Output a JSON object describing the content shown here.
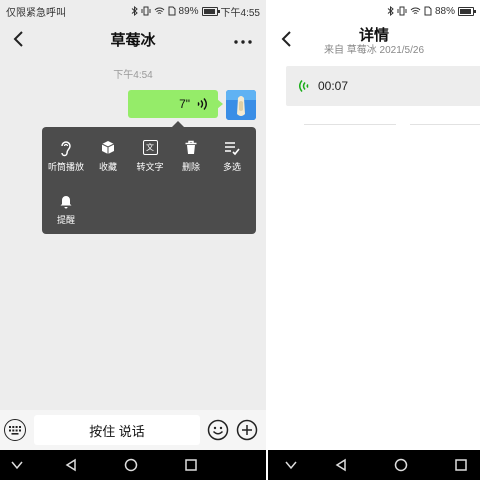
{
  "left": {
    "status": {
      "carrier": "仅限紧急呼叫",
      "battery": "89%",
      "battery_level": 0.89,
      "clock": "下午4:55"
    },
    "nav": {
      "title": "草莓冰",
      "back_icon": "chevron-left-icon",
      "more_icon": "more-icon"
    },
    "chat": {
      "time": "下午4:54",
      "voice_duration": "7\""
    },
    "context_menu": {
      "items": [
        "听筒播放",
        "收藏",
        "转文字",
        "删除",
        "多选",
        "提醒"
      ],
      "icons": [
        "earpiece-icon",
        "cube-icon",
        "text-convert-icon",
        "trash-icon",
        "multi-select-icon",
        "bell-icon"
      ],
      "convert_glyph": "文"
    },
    "input": {
      "hold_to_talk": "按住 说话"
    }
  },
  "right": {
    "status": {
      "battery": "88%",
      "battery_level": 0.88
    },
    "nav": {
      "title": "详情",
      "back_icon": "chevron-left-icon"
    },
    "source": "来自 草莓冰 2021/5/26",
    "voice_duration": "00:07"
  },
  "colors": {
    "bubble": "#95ec69",
    "menu_bg": "#4c4c4c",
    "chat_bg": "#ededed",
    "voice_icon": "#1aad19"
  }
}
